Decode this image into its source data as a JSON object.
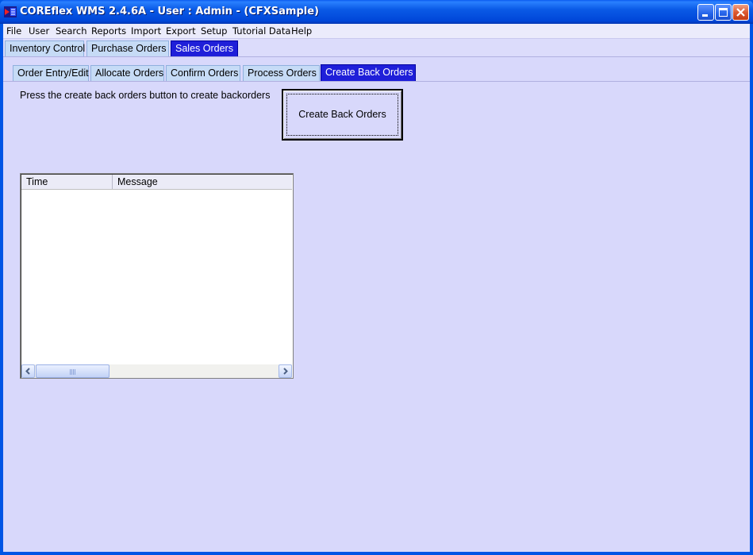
{
  "window": {
    "title": "COREflex WMS 2.4.6A - User : Admin - (CFXSample)"
  },
  "menu": [
    "File",
    "User",
    "Search",
    "Reports",
    "Import",
    "Export",
    "Setup",
    "Tutorial Data",
    "Help"
  ],
  "main_tabs": [
    "Inventory Control",
    "Purchase Orders",
    "Sales Orders"
  ],
  "main_tabs_active": "Sales Orders",
  "sub_tabs": [
    "Order Entry/Edit",
    "Allocate Orders",
    "Confirm Orders",
    "Process Orders",
    "Create Back Orders"
  ],
  "sub_tabs_active": "Create Back Orders",
  "content": {
    "instruction": "Press the create back orders button to create backorders",
    "create_button_label": "Create Back Orders"
  },
  "log_table": {
    "columns": [
      "Time",
      "Message"
    ],
    "rows": []
  },
  "colors": {
    "title_bar": "#0054e3",
    "client_background": "#d8d8fb",
    "active_tab": "#1f1fd9",
    "inactive_tab": "#c6dbf6"
  }
}
